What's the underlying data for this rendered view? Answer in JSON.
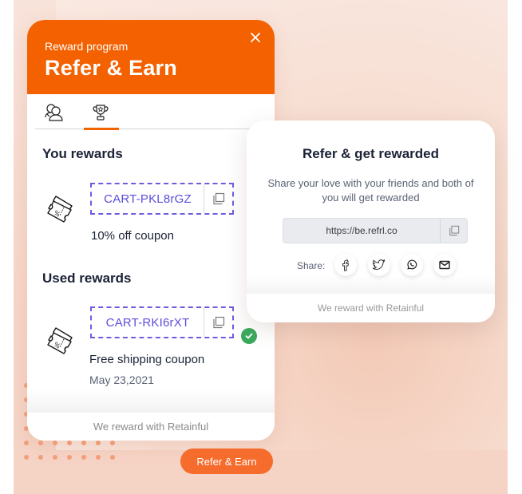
{
  "colors": {
    "brand": "#f36100",
    "code": "#5b4fdc",
    "success": "#3aaa5c",
    "launcher": "#f66c2d"
  },
  "widget": {
    "subtitle": "Reward program",
    "title": "Refer & Earn",
    "close_icon": "close-icon",
    "tabs": [
      {
        "name": "referrals",
        "icon": "users-icon",
        "active": false
      },
      {
        "name": "rewards",
        "icon": "trophy-icon",
        "active": true
      }
    ],
    "your_rewards": {
      "title": "You rewards",
      "items": [
        {
          "code": "CART-PKL8rGZ",
          "label": "10% off coupon",
          "icon": "coupon-icon"
        }
      ]
    },
    "used_rewards": {
      "title": "Used rewards",
      "items": [
        {
          "code": "CART-RKI6rXT",
          "label": "Free shipping coupon",
          "date": "May 23,2021",
          "status": "used",
          "icon": "coupon-icon"
        }
      ]
    },
    "footer": "We reward with Retainful"
  },
  "refer_card": {
    "title": "Refer & get rewarded",
    "description": "Share your love with your friends and both of you will get rewarded",
    "link": "https://be.refrl.co",
    "share_label": "Share:",
    "share_buttons": [
      {
        "name": "facebook",
        "icon": "facebook-icon"
      },
      {
        "name": "twitter",
        "icon": "twitter-icon"
      },
      {
        "name": "whatsapp",
        "icon": "whatsapp-icon"
      },
      {
        "name": "email",
        "icon": "mail-icon"
      }
    ],
    "footer": "We reward with Retainful"
  },
  "launcher": {
    "label": "Refer & Earn"
  }
}
